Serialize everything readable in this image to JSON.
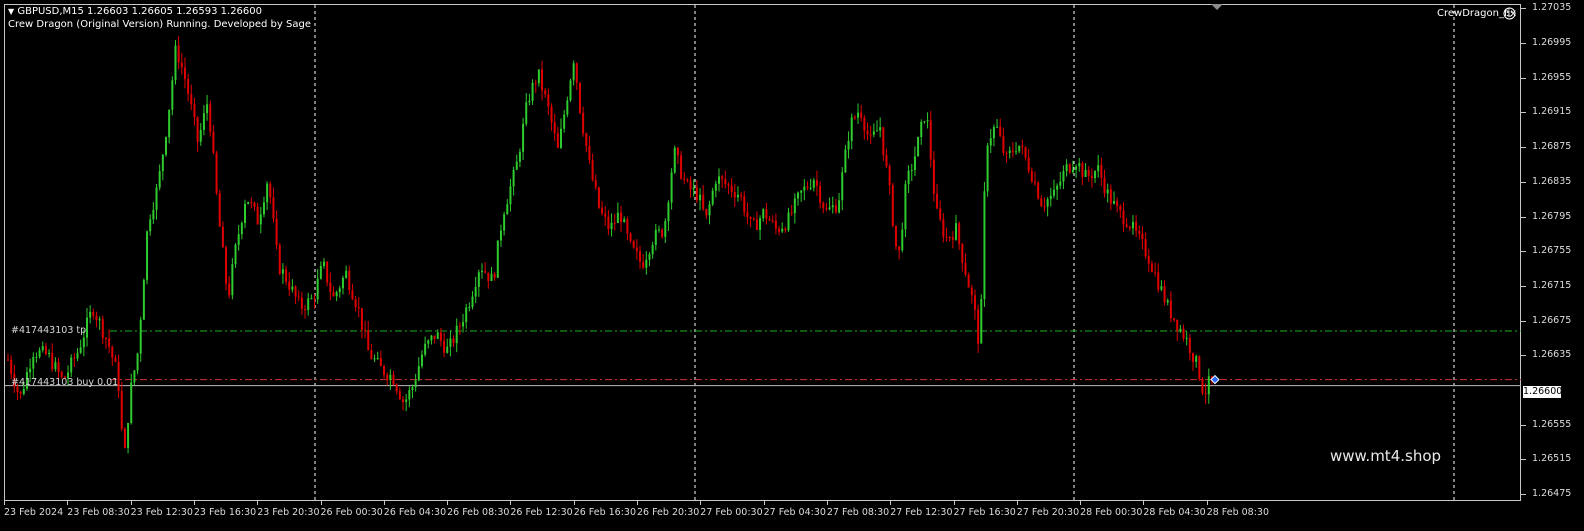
{
  "header": {
    "symbol_line": "GBPUSD,M15  1.26603 1.26605 1.26593 1.26600",
    "ea_status": "Crew Dragon (Original Version) Running. Developed by Sage",
    "expert_name": "CrewDragon_fix"
  },
  "orders": {
    "tp_label": "#417443103 tp",
    "entry_label": "#417443103 buy 0.01",
    "tp_price": 1.26663,
    "entry_price": 1.26607
  },
  "bid": {
    "value": "1.26600",
    "price": 1.266
  },
  "watermark": "www.mt4.shop",
  "colors": {
    "bull": "#2ecc2e",
    "bear": "#e00000",
    "tp_line": "#20b020",
    "entry_line": "#d03030",
    "bid_line": "#bdbdbd",
    "grid": "#ffffff"
  },
  "icons": {
    "expert_status": "smiley-icon",
    "dropdown": "triangle-down-icon",
    "scroll": "scroll-marker-icon"
  },
  "price_axis": {
    "ticks": [
      "1.27035",
      "1.26995",
      "1.26955",
      "1.26915",
      "1.26875",
      "1.26835",
      "1.26795",
      "1.26755",
      "1.26715",
      "1.26675",
      "1.26635",
      "1.26555",
      "1.26515",
      "1.26475"
    ],
    "min": 1.26467,
    "max": 1.2704
  },
  "time_axis": {
    "ticks": [
      "23 Feb 2024",
      "23 Feb 08:30",
      "23 Feb 12:30",
      "23 Feb 16:30",
      "23 Feb 20:30",
      "26 Feb 00:30",
      "26 Feb 04:30",
      "26 Feb 08:30",
      "26 Feb 12:30",
      "26 Feb 16:30",
      "26 Feb 20:30",
      "27 Feb 00:30",
      "27 Feb 04:30",
      "27 Feb 08:30",
      "27 Feb 12:30",
      "27 Feb 16:30",
      "27 Feb 20:30",
      "28 Feb 00:30",
      "28 Feb 04:30",
      "28 Feb 08:30"
    ]
  },
  "chart_data": {
    "type": "candlestick",
    "symbol": "GBPUSD",
    "timeframe": "M15",
    "close_path": [
      [
        0,
        1.2663
      ],
      [
        12,
        1.26585
      ],
      [
        25,
        1.2664
      ],
      [
        40,
        1.26635
      ],
      [
        55,
        1.26605
      ],
      [
        70,
        1.2664
      ],
      [
        85,
        1.2669
      ],
      [
        100,
        1.2665
      ],
      [
        110,
        1.2661
      ],
      [
        116,
        1.2651
      ],
      [
        122,
        1.2659
      ],
      [
        130,
        1.2664
      ],
      [
        140,
        1.2679
      ],
      [
        150,
        1.2683
      ],
      [
        160,
        1.2691
      ],
      [
        168,
        1.2699
      ],
      [
        178,
        1.2695
      ],
      [
        190,
        1.2688
      ],
      [
        200,
        1.2693
      ],
      [
        210,
        1.268
      ],
      [
        220,
        1.267
      ],
      [
        228,
        1.2676
      ],
      [
        238,
        1.2682
      ],
      [
        250,
        1.2679
      ],
      [
        260,
        1.2684
      ],
      [
        270,
        1.2674
      ],
      [
        280,
        1.2672
      ],
      [
        292,
        1.2669
      ],
      [
        305,
        1.267
      ],
      [
        315,
        1.2674
      ],
      [
        325,
        1.267
      ],
      [
        338,
        1.2673
      ],
      [
        350,
        1.2669
      ],
      [
        360,
        1.2664
      ],
      [
        372,
        1.2662
      ],
      [
        385,
        1.2661
      ],
      [
        396,
        1.2658
      ],
      [
        405,
        1.266
      ],
      [
        415,
        1.2664
      ],
      [
        428,
        1.2666
      ],
      [
        440,
        1.2664
      ],
      [
        452,
        1.2667
      ],
      [
        462,
        1.267
      ],
      [
        472,
        1.2674
      ],
      [
        485,
        1.2672
      ],
      [
        495,
        1.268
      ],
      [
        508,
        1.2685
      ],
      [
        520,
        1.2693
      ],
      [
        530,
        1.2696
      ],
      [
        540,
        1.2692
      ],
      [
        550,
        1.2687
      ],
      [
        560,
        1.2694
      ],
      [
        566,
        1.2698
      ],
      [
        572,
        1.2692
      ],
      [
        582,
        1.2685
      ],
      [
        592,
        1.268
      ],
      [
        602,
        1.2678
      ],
      [
        612,
        1.268
      ],
      [
        622,
        1.2676
      ],
      [
        634,
        1.2674
      ],
      [
        645,
        1.2677
      ],
      [
        656,
        1.2678
      ],
      [
        666,
        1.2687
      ],
      [
        678,
        1.2683
      ],
      [
        690,
        1.2682
      ],
      [
        698,
        1.2679
      ],
      [
        708,
        1.2684
      ],
      [
        720,
        1.2683
      ],
      [
        732,
        1.2682
      ],
      [
        744,
        1.2678
      ],
      [
        756,
        1.268
      ],
      [
        768,
        1.2678
      ],
      [
        780,
        1.2679
      ],
      [
        792,
        1.2682
      ],
      [
        806,
        1.2684
      ],
      [
        818,
        1.268
      ],
      [
        830,
        1.2681
      ],
      [
        842,
        1.269
      ],
      [
        852,
        1.2692
      ],
      [
        862,
        1.2688
      ],
      [
        872,
        1.269
      ],
      [
        882,
        1.2682
      ],
      [
        890,
        1.2674
      ],
      [
        898,
        1.2683
      ],
      [
        908,
        1.2687
      ],
      [
        918,
        1.2692
      ],
      [
        928,
        1.268
      ],
      [
        938,
        1.2677
      ],
      [
        948,
        1.2678
      ],
      [
        958,
        1.2673
      ],
      [
        966,
        1.2669
      ],
      [
        972,
        1.2664
      ],
      [
        978,
        1.2688
      ],
      [
        988,
        1.269
      ],
      [
        998,
        1.2686
      ],
      [
        1010,
        1.2688
      ],
      [
        1022,
        1.2685
      ],
      [
        1034,
        1.2681
      ],
      [
        1046,
        1.2682
      ],
      [
        1058,
        1.2685
      ],
      [
        1068,
        1.2686
      ],
      [
        1078,
        1.2684
      ],
      [
        1090,
        1.2685
      ],
      [
        1100,
        1.2682
      ],
      [
        1110,
        1.268
      ],
      [
        1120,
        1.2679
      ],
      [
        1130,
        1.2677
      ],
      [
        1140,
        1.2675
      ],
      [
        1150,
        1.2672
      ],
      [
        1160,
        1.2669
      ],
      [
        1170,
        1.2667
      ],
      [
        1180,
        1.2665
      ],
      [
        1190,
        1.2662
      ],
      [
        1196,
        1.2659
      ],
      [
        1202,
        1.26605
      ],
      [
        1208,
        1.266
      ]
    ]
  }
}
